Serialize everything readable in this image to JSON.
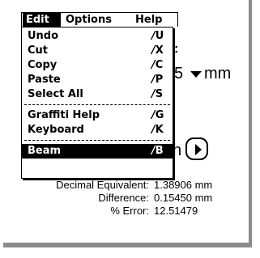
{
  "menubar": {
    "items": [
      {
        "label": "Edit",
        "active": true
      },
      {
        "label": "Options",
        "active": false
      },
      {
        "label": "Help",
        "active": false
      }
    ]
  },
  "edit_menu": {
    "groups": [
      [
        {
          "label": "Undo",
          "shortcut": "U"
        },
        {
          "label": "Cut",
          "shortcut": "X"
        },
        {
          "label": "Copy",
          "shortcut": "C"
        },
        {
          "label": "Paste",
          "shortcut": "P"
        },
        {
          "label": "Select All",
          "shortcut": "S"
        }
      ],
      [
        {
          "label": "Graffiti Help",
          "shortcut": "G"
        },
        {
          "label": "Keyboard",
          "shortcut": "K"
        }
      ],
      [
        {
          "label": "Beam",
          "shortcut": "B",
          "highlighted": true
        }
      ]
    ],
    "stroke_glyph": "⁄"
  },
  "background": {
    "colon": ":",
    "value_partial": "5",
    "unit": "mm",
    "partial_letter": "h"
  },
  "results": [
    {
      "label": "Decimal Equivalent:",
      "value": "1.38906 mm"
    },
    {
      "label": "Difference:",
      "value": "0.15450 mm"
    },
    {
      "label": "% Error:",
      "value": "12.51479"
    }
  ],
  "colors": {
    "background": "#ffffff",
    "foreground": "#000000",
    "frame": "#8c8c8c",
    "highlight_bg": "#000000",
    "highlight_fg": "#ffffff"
  }
}
